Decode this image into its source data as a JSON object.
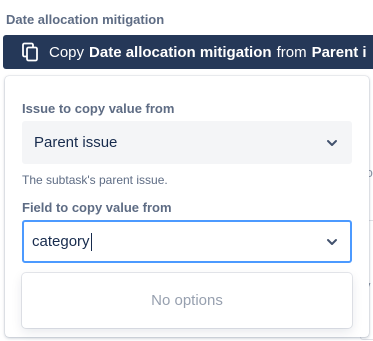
{
  "section_label": "Date allocation mitigation",
  "copy_bar": {
    "icon": "copy-icon",
    "prefix": "Copy",
    "field_name": "Date allocation mitigation",
    "middle": "from",
    "source": "Parent i"
  },
  "background_fragments": [
    "fo",
    "y"
  ],
  "popup": {
    "issue_label": "Issue to copy value from",
    "issue_value": "Parent issue",
    "issue_help": "The subtask's parent issue.",
    "field_label": "Field to copy value from",
    "field_input": "category",
    "no_options": "No options"
  },
  "colors": {
    "bar_bg": "#253858",
    "focus_border": "#4c9aff",
    "label": "#5e6c84",
    "muted": "#97a0af"
  }
}
